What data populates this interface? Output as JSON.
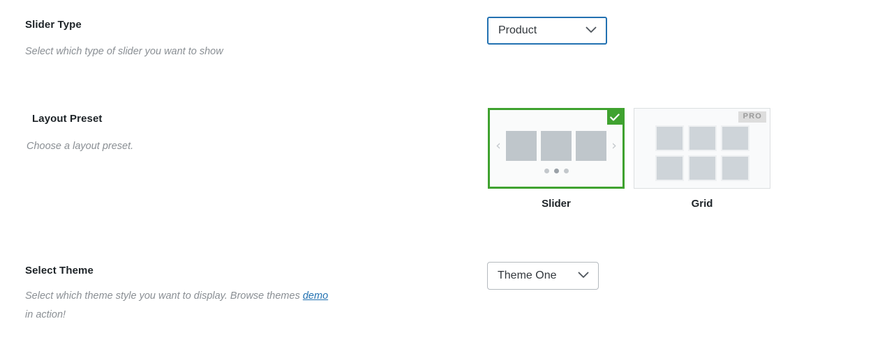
{
  "fields": {
    "slider_type": {
      "label": "Slider Type",
      "description": "Select which type of slider you want to show",
      "value": "Product"
    },
    "layout_preset": {
      "label": "Layout Preset",
      "description": "Choose a layout preset.",
      "options": [
        {
          "caption": "Slider",
          "selected": true,
          "badge": ""
        },
        {
          "caption": "Grid",
          "selected": false,
          "badge": "PRO"
        }
      ]
    },
    "select_theme": {
      "label": "Select Theme",
      "description_part1": "Select which theme style you want to display. Browse themes ",
      "link_text": "demo",
      "description_part2": " in action!",
      "value": "Theme One"
    }
  },
  "icons": {
    "chevron_down": "chevron-down-icon",
    "check": "check-icon",
    "prev_arrow": "‹",
    "next_arrow": "›"
  },
  "colors": {
    "focus_border": "#2271b1",
    "selected_border": "#3fa22f",
    "link": "#2271b1",
    "pro_badge_bg": "#dddddd"
  }
}
